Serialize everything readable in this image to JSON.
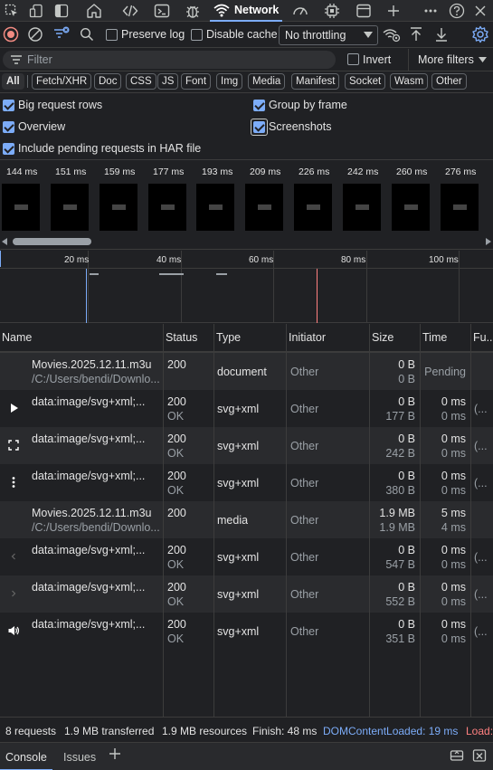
{
  "tabs": {
    "active_label": "Network"
  },
  "toolbar": {
    "preserve_log": "Preserve log",
    "disable_cache": "Disable cache",
    "throttling": "No throttling"
  },
  "filter": {
    "placeholder": "Filter",
    "invert": "Invert",
    "more_filters": "More filters"
  },
  "type_filters": [
    "All",
    "Fetch/XHR",
    "Doc",
    "CSS",
    "JS",
    "Font",
    "Img",
    "Media",
    "Manifest",
    "Socket",
    "Wasm",
    "Other"
  ],
  "options": {
    "big_rows": "Big request rows",
    "group_frame": "Group by frame",
    "overview": "Overview",
    "screenshots": "Screenshots",
    "har": "Include pending requests in HAR file"
  },
  "screenshot_times": [
    "144 ms",
    "151 ms",
    "159 ms",
    "177 ms",
    "193 ms",
    "209 ms",
    "226 ms",
    "242 ms",
    "260 ms",
    "276 ms"
  ],
  "overview_ticks": [
    "20 ms",
    "40 ms",
    "60 ms",
    "80 ms",
    "100 ms"
  ],
  "columns": {
    "name": "Name",
    "status": "Status",
    "type": "Type",
    "initiator": "Initiator",
    "size": "Size",
    "time": "Time",
    "fulfilled": "Fu..."
  },
  "rows": [
    {
      "icon": "none",
      "name": "Movies.2025.12.11.m3u",
      "path": "/C:/Users/bendi/Downlo...",
      "status": "200",
      "status_text": "",
      "type": "document",
      "initiator": "Other",
      "size": "0 B",
      "size2": "0 B",
      "time": "Pending",
      "time2": "",
      "fu": ""
    },
    {
      "icon": "play-icon",
      "name": "data:image/svg+xml;...",
      "path": "",
      "status": "200",
      "status_text": "OK",
      "type": "svg+xml",
      "initiator": "Other",
      "size": "0 B",
      "size2": "177 B",
      "time": "0 ms",
      "time2": "0 ms",
      "fu": "(..."
    },
    {
      "icon": "fullscreen-icon",
      "name": "data:image/svg+xml;...",
      "path": "",
      "status": "200",
      "status_text": "OK",
      "type": "svg+xml",
      "initiator": "Other",
      "size": "0 B",
      "size2": "242 B",
      "time": "0 ms",
      "time2": "0 ms",
      "fu": "(..."
    },
    {
      "icon": "more-vert-icon",
      "name": "data:image/svg+xml;...",
      "path": "",
      "status": "200",
      "status_text": "OK",
      "type": "svg+xml",
      "initiator": "Other",
      "size": "0 B",
      "size2": "380 B",
      "time": "0 ms",
      "time2": "0 ms",
      "fu": "(..."
    },
    {
      "icon": "none",
      "name": "Movies.2025.12.11.m3u",
      "path": "/C:/Users/bendi/Downlo...",
      "status": "200",
      "status_text": "",
      "type": "media",
      "initiator": "Other",
      "size": "1.9 MB",
      "size2": "1.9 MB",
      "time": "5 ms",
      "time2": "4 ms",
      "fu": ""
    },
    {
      "icon": "chevron-left-icon",
      "name": "data:image/svg+xml;...",
      "path": "",
      "status": "200",
      "status_text": "OK",
      "type": "svg+xml",
      "initiator": "Other",
      "size": "0 B",
      "size2": "547 B",
      "time": "0 ms",
      "time2": "0 ms",
      "fu": "(..."
    },
    {
      "icon": "chevron-right-icon",
      "name": "data:image/svg+xml;...",
      "path": "",
      "status": "200",
      "status_text": "OK",
      "type": "svg+xml",
      "initiator": "Other",
      "size": "0 B",
      "size2": "552 B",
      "time": "0 ms",
      "time2": "0 ms",
      "fu": "(..."
    },
    {
      "icon": "volume-icon",
      "name": "data:image/svg+xml;...",
      "path": "",
      "status": "200",
      "status_text": "OK",
      "type": "svg+xml",
      "initiator": "Other",
      "size": "0 B",
      "size2": "351 B",
      "time": "0 ms",
      "time2": "0 ms",
      "fu": "(..."
    }
  ],
  "status_bar": {
    "requests": "8 requests",
    "transferred": "1.9 MB transferred",
    "resources": "1.9 MB resources",
    "finish": "Finish: 48 ms",
    "dcl": "DOMContentLoaded: 19 ms",
    "load": "Load:"
  },
  "drawer": {
    "console": "Console",
    "issues": "Issues",
    "add": "+"
  },
  "colors": {
    "accent": "#7cacf8",
    "dcl": "#7cacf8",
    "load": "#ff8080"
  }
}
